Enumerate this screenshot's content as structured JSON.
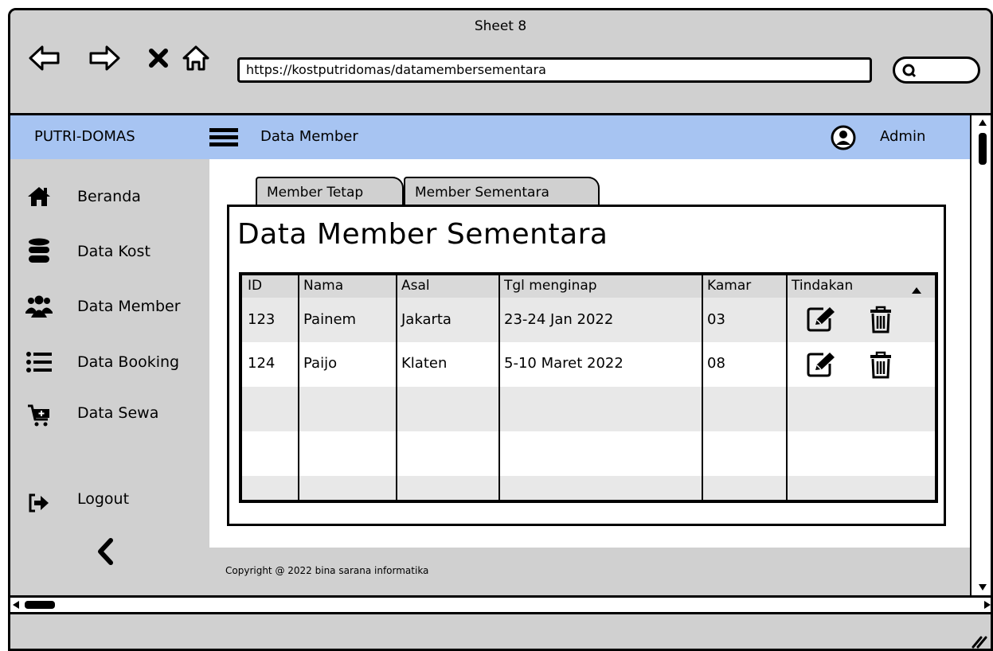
{
  "window": {
    "title": "Sheet 8"
  },
  "browser": {
    "url": "https://kostputridomas/datamembersementara",
    "nav_icons": [
      "back-arrow-icon",
      "forward-arrow-icon",
      "stop-icon",
      "home-icon"
    ],
    "search_icon": "search-icon"
  },
  "appbar": {
    "brand": "PUTRI-DOMAS",
    "title": "Data Member",
    "user": "Admin",
    "color": "#a7c4f2"
  },
  "sidebar": {
    "items": [
      {
        "label": "Beranda",
        "icon": "home-icon"
      },
      {
        "label": "Data Kost",
        "icon": "database-icon"
      },
      {
        "label": "Data Member",
        "icon": "users-icon"
      },
      {
        "label": "Data Booking",
        "icon": "list-icon"
      },
      {
        "label": "Data Sewa",
        "icon": "cart-icon"
      },
      {
        "label": "Logout",
        "icon": "logout-icon"
      }
    ],
    "collapse_icon": "chevron-left-icon"
  },
  "tabs": [
    {
      "label": "Member Tetap"
    },
    {
      "label": "Member Sementara",
      "active": true
    }
  ],
  "panel": {
    "title": "Data Member Sementara"
  },
  "table": {
    "columns": [
      "ID",
      "Nama",
      "Asal",
      "Tgl menginap",
      "Kamar",
      "Tindakan"
    ],
    "rows": [
      [
        "123",
        "Painem",
        "Jakarta",
        "23-24 Jan 2022",
        "03"
      ],
      [
        "124",
        "Paijo",
        "Klaten",
        "5-10 Maret 2022",
        "08"
      ]
    ],
    "row_actions": [
      "edit-icon",
      "delete-icon"
    ]
  },
  "footer": {
    "text": "Copyright @ 2022 bina sarana informatika"
  }
}
